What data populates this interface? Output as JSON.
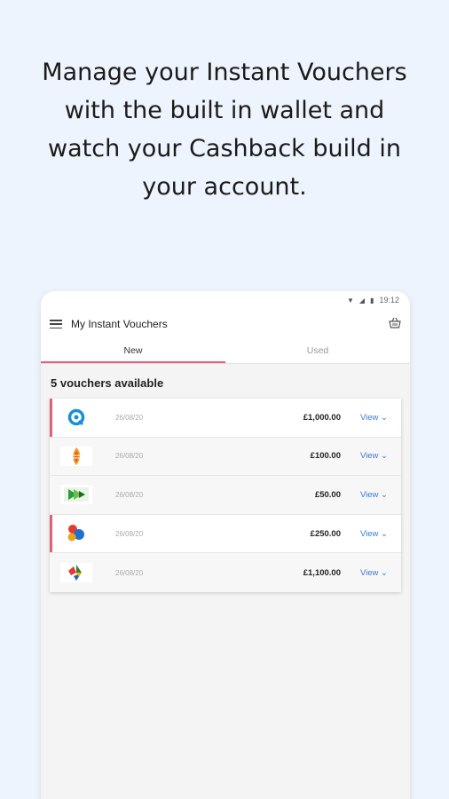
{
  "headline": "Manage your Instant Vouchers with the built in wallet and watch your Cashback build in your account.",
  "status": {
    "time": "19:12"
  },
  "appbar": {
    "title": "My Instant Vouchers"
  },
  "tabs": [
    {
      "label": "New"
    },
    {
      "label": "Used"
    }
  ],
  "summary": "5 vouchers available",
  "vouchers": [
    {
      "logo": "blue-ring-logo",
      "date": "26/08/20",
      "amount": "£1,000.00",
      "action": "View ⌄"
    },
    {
      "logo": "orange-flame-logo",
      "date": "26/08/20",
      "amount": "£100.00",
      "action": "View ⌄"
    },
    {
      "logo": "green-arrow-logo",
      "date": "26/08/20",
      "amount": "£50.00",
      "action": "View ⌄"
    },
    {
      "logo": "colored-circles-logo",
      "date": "26/08/20",
      "amount": "£250.00",
      "action": "View ⌄"
    },
    {
      "logo": "recycle-logo",
      "date": "26/08/20",
      "amount": "£1,100.00",
      "action": "View ⌄"
    }
  ],
  "colors": {
    "background": "#eef4fd",
    "accent": "#e0607a",
    "link": "#3a7bd5"
  }
}
